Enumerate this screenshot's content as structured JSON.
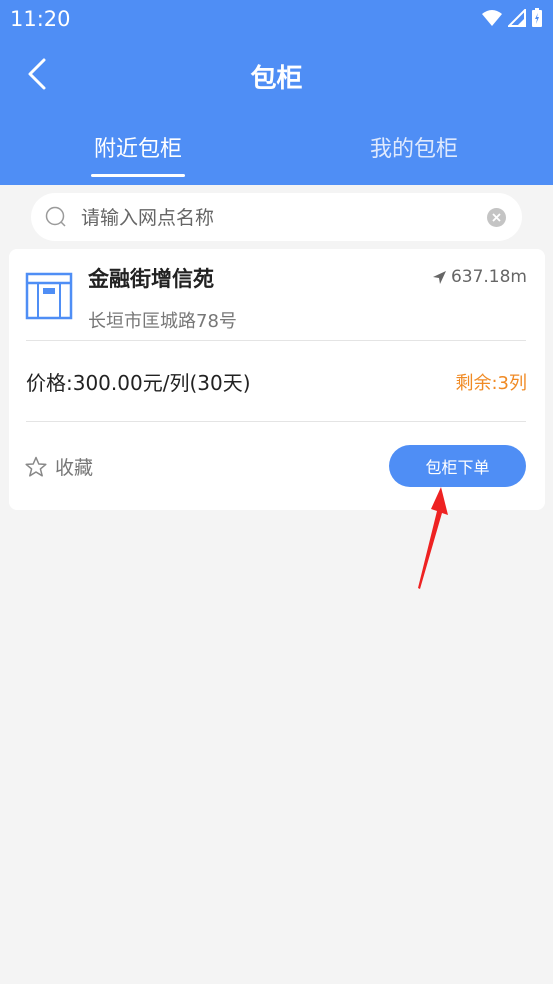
{
  "status_bar": {
    "time": "11:20"
  },
  "header": {
    "title": "包柜"
  },
  "tabs": [
    {
      "label": "附近包柜",
      "active": true
    },
    {
      "label": "我的包柜",
      "active": false
    }
  ],
  "search": {
    "placeholder": "请输入网点名称",
    "value": ""
  },
  "card": {
    "name": "金融街增信苑",
    "address": "长垣市匡城路78号",
    "distance": "637.18m",
    "price": "价格:300.00元/列(30天)",
    "remaining": "剩余:3列",
    "favorite_label": "收藏",
    "order_button": "包柜下单"
  },
  "colors": {
    "primary": "#4f8ef5",
    "remaining": "#f08a24",
    "annotation_arrow": "#ee2222"
  }
}
